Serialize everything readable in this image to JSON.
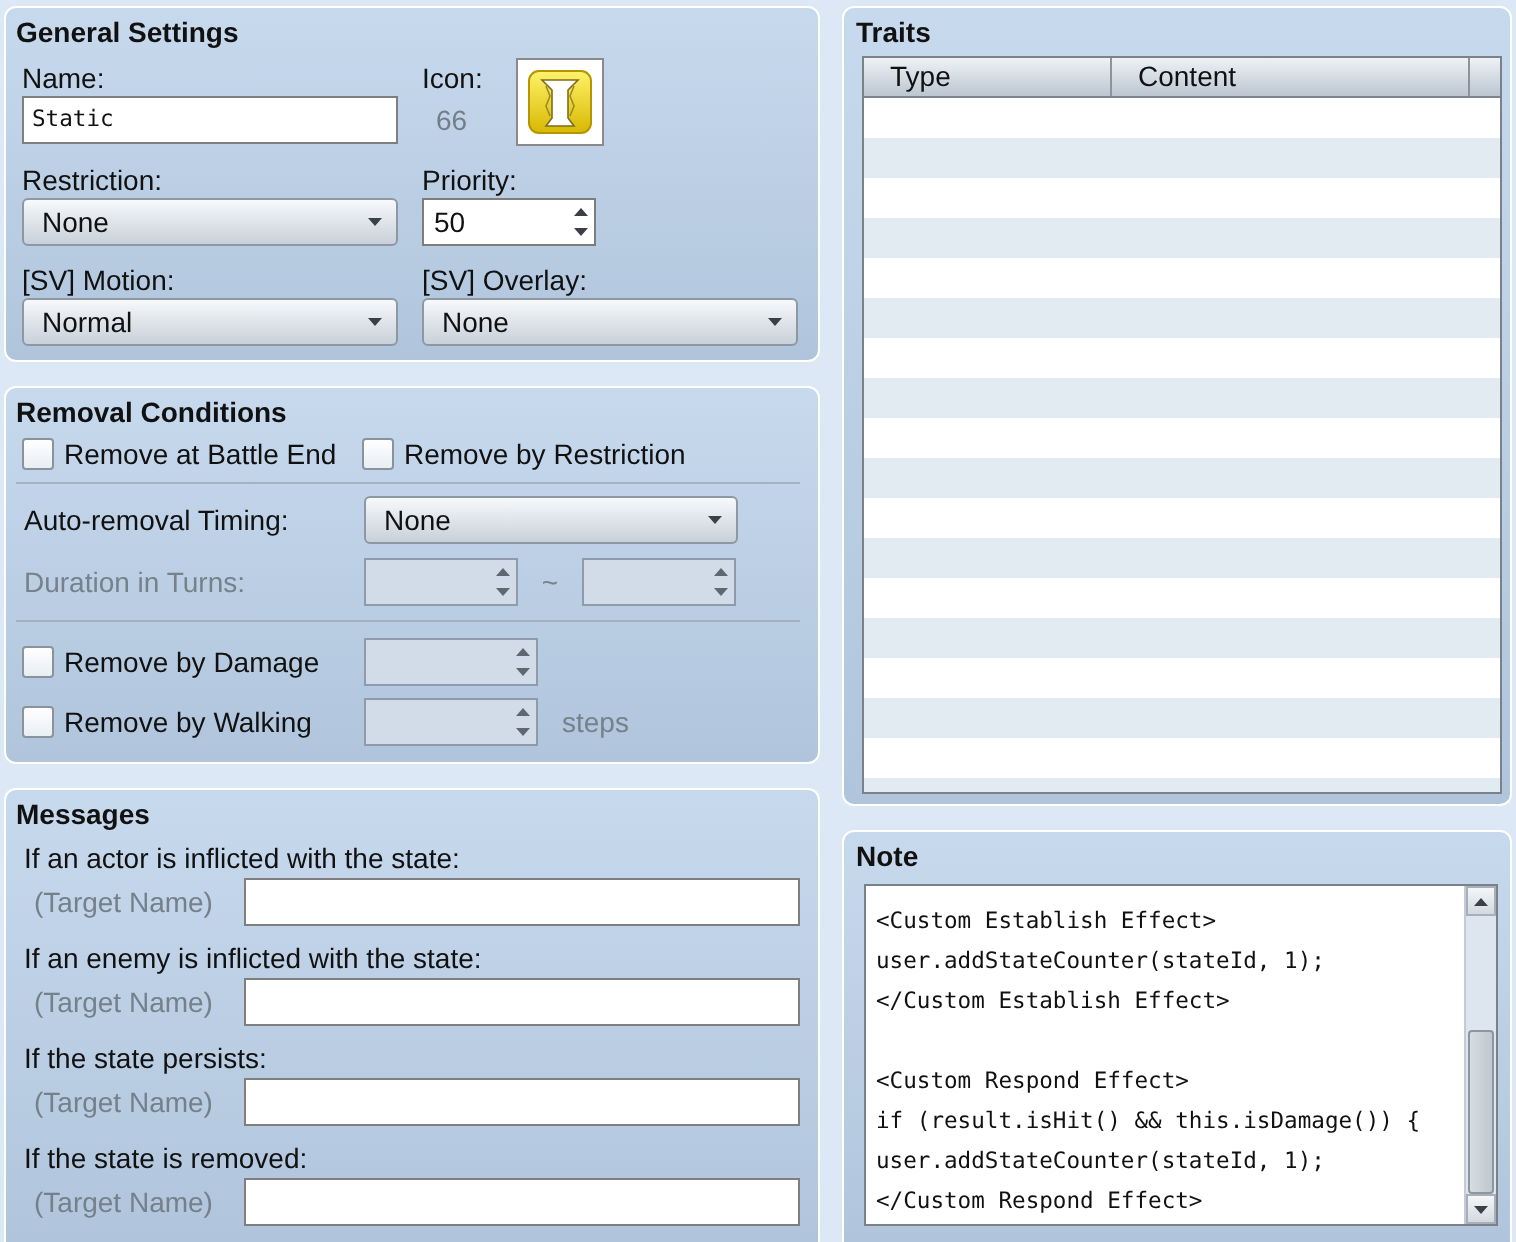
{
  "general_settings": {
    "title": "General Settings",
    "name": {
      "label": "Name:",
      "value": "Static"
    },
    "icon": {
      "label": "Icon:",
      "index": "66"
    },
    "restriction": {
      "label": "Restriction:",
      "value": "None"
    },
    "priority": {
      "label": "Priority:",
      "value": "50"
    },
    "sv_motion": {
      "label": "[SV] Motion:",
      "value": "Normal"
    },
    "sv_overlay": {
      "label": "[SV] Overlay:",
      "value": "None"
    }
  },
  "removal_conditions": {
    "title": "Removal Conditions",
    "options": [
      {
        "label": "Remove at Battle End",
        "checked": false
      },
      {
        "label": "Remove by Restriction",
        "checked": false
      }
    ],
    "auto_removal_timing": {
      "label": "Auto-removal Timing:",
      "value": "None"
    },
    "duration_in_turns": {
      "label": "Duration in Turns:",
      "disabled": true,
      "separator": "~"
    },
    "remove_by_damage": {
      "label": "Remove by Damage",
      "checked": false,
      "field_disabled": true
    },
    "remove_by_walking": {
      "label": "Remove by Walking",
      "checked": false,
      "field_disabled": true,
      "unit": "steps"
    }
  },
  "messages": {
    "title": "Messages",
    "items": [
      {
        "label": "If an actor is inflicted with the state:",
        "target": "(Target Name)"
      },
      {
        "label": "If an enemy is inflicted with the state:",
        "target": "(Target Name)"
      },
      {
        "label": "If the state persists:",
        "target": "(Target Name)"
      },
      {
        "label": "If the state is removed:",
        "target": "(Target Name)"
      }
    ]
  },
  "traits": {
    "title": "Traits",
    "columns": [
      "Type",
      "Content"
    ]
  },
  "note": {
    "title": "Note",
    "value": "<Custom Establish Effect>\nuser.addStateCounter(stateId, 1);\n</Custom Establish Effect>\n\n<Custom Respond Effect>\nif (result.isHit() && this.isDamage()) {\nuser.addStateCounter(stateId, 1);\n</Custom Respond Effect>"
  }
}
